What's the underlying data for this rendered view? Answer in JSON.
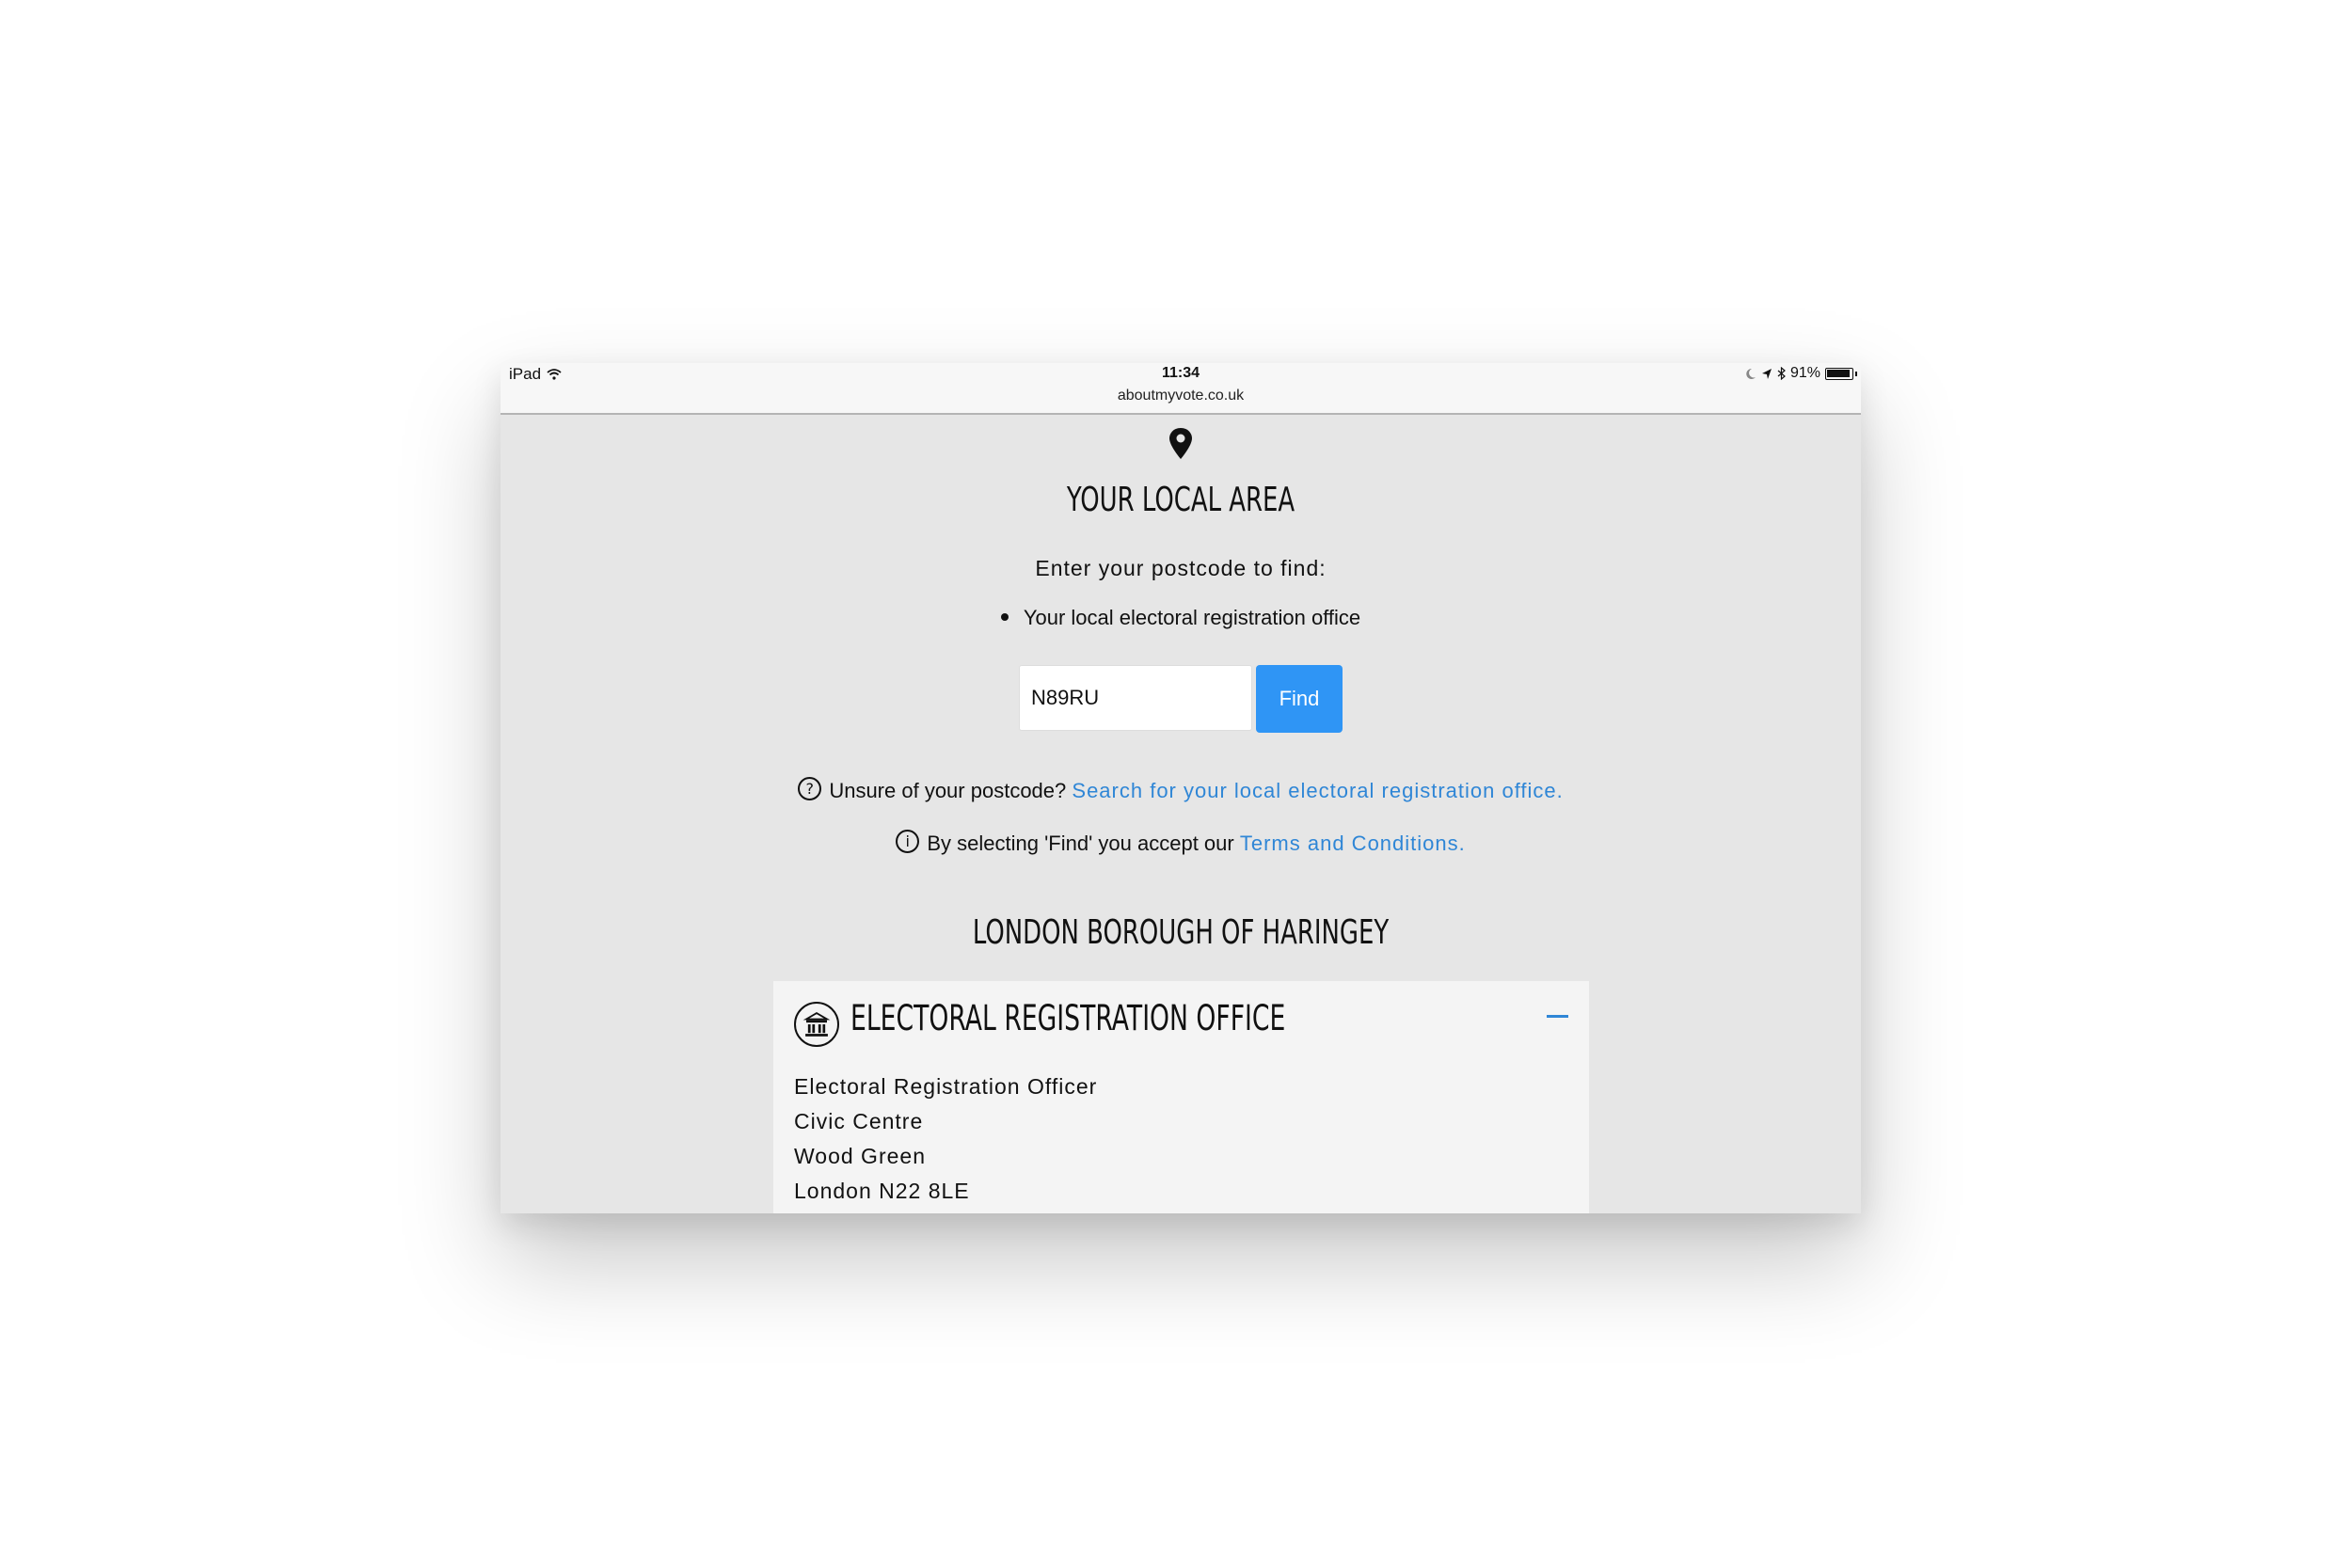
{
  "status_bar": {
    "carrier": "iPad",
    "time": "11:34",
    "battery": "91%",
    "url": "aboutmyvote.co.uk"
  },
  "page": {
    "title": "YOUR LOCAL AREA",
    "lead": "Enter your postcode to find:",
    "bullet": "Your local electoral registration office",
    "postcode_value": "N89RU",
    "find_label": "Find",
    "unsure_text": "Unsure of your postcode?",
    "unsure_link": "Search for your local electoral registration office.",
    "terms_text": "By selecting 'Find' you accept our",
    "terms_link": "Terms and Conditions.",
    "borough": "LONDON BOROUGH OF HARINGEY"
  },
  "office": {
    "title": "ELECTORAL REGISTRATION OFFICE",
    "address": [
      "Electoral Registration Officer",
      "Civic Centre",
      "Wood Green",
      "London N22 8LE"
    ]
  },
  "colors": {
    "accent": "#2f95f5",
    "link": "#2f86d6",
    "background": "#e6e6e6"
  },
  "icons": [
    "wifi-icon",
    "moon-icon",
    "location-arrow-icon",
    "bluetooth-icon",
    "battery-icon",
    "map-pin-icon",
    "question-circle-icon",
    "info-circle-icon",
    "building-icon",
    "minus-icon"
  ]
}
